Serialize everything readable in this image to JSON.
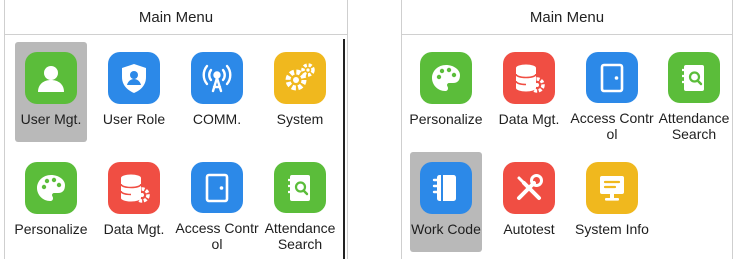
{
  "left_screen": {
    "title": "Main Menu",
    "items": [
      {
        "label": "User Mgt.",
        "icon": "user-icon",
        "color": "#5bbd3a"
      },
      {
        "label": "User Role",
        "icon": "shield-user-icon",
        "color": "#2c89e8"
      },
      {
        "label": "COMM.",
        "icon": "antenna-icon",
        "color": "#2c89e8"
      },
      {
        "label": "System",
        "icon": "gears-icon",
        "color": "#f0b81e"
      },
      {
        "label": "Personalize",
        "icon": "palette-icon",
        "color": "#5bbd3a"
      },
      {
        "label": "Data Mgt.",
        "icon": "database-gear-icon",
        "color": "#f04e43"
      },
      {
        "label": "Access Control",
        "icon": "door-icon",
        "color": "#2c89e8"
      },
      {
        "label": "Attendance Search",
        "icon": "search-document-icon",
        "color": "#5bbd3a"
      }
    ]
  },
  "right_screen": {
    "title": "Main Menu",
    "items": [
      {
        "label": "Personalize",
        "icon": "palette-icon",
        "color": "#5bbd3a"
      },
      {
        "label": "Data Mgt.",
        "icon": "database-gear-icon",
        "color": "#f04e43"
      },
      {
        "label": "Access Control",
        "icon": "door-icon",
        "color": "#2c89e8"
      },
      {
        "label": "Attendance Search",
        "icon": "search-document-icon",
        "color": "#5bbd3a"
      },
      {
        "label": "Work Code",
        "icon": "notebook-icon",
        "color": "#2c89e8"
      },
      {
        "label": "Autotest",
        "icon": "tools-icon",
        "color": "#f04e43"
      },
      {
        "label": "System Info",
        "icon": "info-screen-icon",
        "color": "#f0b81e"
      }
    ]
  }
}
